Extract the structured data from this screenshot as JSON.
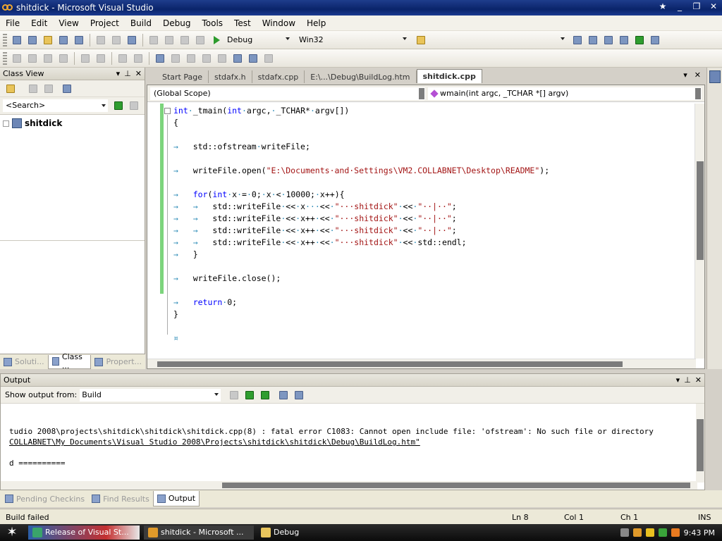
{
  "window": {
    "title": "shitdick - Microsoft Visual Studio"
  },
  "menu": [
    "File",
    "Edit",
    "View",
    "Project",
    "Build",
    "Debug",
    "Tools",
    "Test",
    "Window",
    "Help"
  ],
  "toolbar": {
    "config": "Debug",
    "platform": "Win32"
  },
  "class_view": {
    "title": "Class View",
    "search_placeholder": "<Search>",
    "tree_root": "shitdick",
    "tabs": [
      "Soluti...",
      "Class ...",
      "Propert..."
    ]
  },
  "editor": {
    "tabs": [
      "Start Page",
      "stdafx.h",
      "stdafx.cpp",
      "E:\\...\\Debug\\BuildLog.htm",
      "shitdick.cpp"
    ],
    "active_tab": "shitdick.cpp",
    "scope": "(Global Scope)",
    "member": "wmain(int argc, _TCHAR *[] argv)",
    "lines": [
      [
        [
          "kw",
          "int"
        ],
        [
          "ws",
          "·"
        ],
        [
          "plain",
          "_tmain("
        ],
        [
          "kw",
          "int"
        ],
        [
          "ws",
          "·"
        ],
        [
          "plain",
          "argc,"
        ],
        [
          "ws",
          "·"
        ],
        [
          "plain",
          "_TCHAR*"
        ],
        [
          "ws",
          "·"
        ],
        [
          "plain",
          "argv[])"
        ]
      ],
      [
        [
          "plain",
          "{"
        ]
      ],
      [],
      [
        [
          "ws",
          "→   "
        ],
        [
          "plain",
          "std::ofstream"
        ],
        [
          "ws",
          "·"
        ],
        [
          "plain",
          "writeFile;"
        ]
      ],
      [],
      [
        [
          "ws",
          "→   "
        ],
        [
          "plain",
          "writeFile.open("
        ],
        [
          "str",
          "\"E:\\Documents·and·Settings\\VM2.COLLABNET\\Desktop\\README\""
        ],
        [
          "plain",
          ");"
        ]
      ],
      [],
      [
        [
          "ws",
          "→   "
        ],
        [
          "kw",
          "for"
        ],
        [
          "plain",
          "("
        ],
        [
          "kw",
          "int"
        ],
        [
          "ws",
          "·"
        ],
        [
          "plain",
          "x"
        ],
        [
          "ws",
          "·"
        ],
        [
          "plain",
          "="
        ],
        [
          "ws",
          "·"
        ],
        [
          "plain",
          "0;"
        ],
        [
          "ws",
          "·"
        ],
        [
          "plain",
          "x"
        ],
        [
          "ws",
          "·"
        ],
        [
          "plain",
          "<"
        ],
        [
          "ws",
          "·"
        ],
        [
          "plain",
          "10000;"
        ],
        [
          "ws",
          "·"
        ],
        [
          "plain",
          "x++){"
        ]
      ],
      [
        [
          "ws",
          "→   →   "
        ],
        [
          "plain",
          "std::writeFile"
        ],
        [
          "ws",
          "·"
        ],
        [
          "plain",
          "<<"
        ],
        [
          "ws",
          "·"
        ],
        [
          "plain",
          "x"
        ],
        [
          "ws",
          "···"
        ],
        [
          "plain",
          "<<"
        ],
        [
          "ws",
          "·"
        ],
        [
          "str",
          "\"···shitdick\""
        ],
        [
          "ws",
          "·"
        ],
        [
          "plain",
          "<<"
        ],
        [
          "ws",
          "·"
        ],
        [
          "str",
          "\"··|··\""
        ],
        [
          "plain",
          ";"
        ]
      ],
      [
        [
          "ws",
          "→   →   "
        ],
        [
          "plain",
          "std::writeFile"
        ],
        [
          "ws",
          "·"
        ],
        [
          "plain",
          "<<"
        ],
        [
          "ws",
          "·"
        ],
        [
          "plain",
          "x++"
        ],
        [
          "ws",
          "·"
        ],
        [
          "plain",
          "<<"
        ],
        [
          "ws",
          "·"
        ],
        [
          "str",
          "\"···shitdick\""
        ],
        [
          "ws",
          "·"
        ],
        [
          "plain",
          "<<"
        ],
        [
          "ws",
          "·"
        ],
        [
          "str",
          "\"··|··\""
        ],
        [
          "plain",
          ";"
        ]
      ],
      [
        [
          "ws",
          "→   →   "
        ],
        [
          "plain",
          "std::writeFile"
        ],
        [
          "ws",
          "·"
        ],
        [
          "plain",
          "<<"
        ],
        [
          "ws",
          "·"
        ],
        [
          "plain",
          "x++"
        ],
        [
          "ws",
          "·"
        ],
        [
          "plain",
          "<<"
        ],
        [
          "ws",
          "·"
        ],
        [
          "str",
          "\"···shitdick\""
        ],
        [
          "ws",
          "·"
        ],
        [
          "plain",
          "<<"
        ],
        [
          "ws",
          "·"
        ],
        [
          "str",
          "\"··|··\""
        ],
        [
          "plain",
          ";"
        ]
      ],
      [
        [
          "ws",
          "→   →   "
        ],
        [
          "plain",
          "std::writeFile"
        ],
        [
          "ws",
          "·"
        ],
        [
          "plain",
          "<<"
        ],
        [
          "ws",
          "·"
        ],
        [
          "plain",
          "x++"
        ],
        [
          "ws",
          "·"
        ],
        [
          "plain",
          "<<"
        ],
        [
          "ws",
          "·"
        ],
        [
          "str",
          "\"···shitdick\""
        ],
        [
          "ws",
          "·"
        ],
        [
          "plain",
          "<<"
        ],
        [
          "ws",
          "·"
        ],
        [
          "plain",
          "std::endl;"
        ]
      ],
      [
        [
          "ws",
          "→   "
        ],
        [
          "plain",
          "}"
        ]
      ],
      [],
      [
        [
          "ws",
          "→   "
        ],
        [
          "plain",
          "writeFile.close();"
        ]
      ],
      [],
      [
        [
          "ws",
          "→   "
        ],
        [
          "kw",
          "return"
        ],
        [
          "ws",
          "·"
        ],
        [
          "plain",
          "0;"
        ]
      ],
      [
        [
          "plain",
          "}"
        ]
      ],
      [],
      [
        [
          "ws",
          "¤"
        ]
      ]
    ]
  },
  "output": {
    "title": "Output",
    "show_from_label": "Show output from:",
    "show_from_value": "Build",
    "lines": [
      "tudio 2008\\projects\\shitdick\\shitdick\\shitdick.cpp(8) : fatal error C1083: Cannot open include file: 'ofstream': No such file or directory",
      "COLLABNET\\My Documents\\Visual Studio 2008\\Projects\\shitdick\\shitdick\\Debug\\BuildLog.htm\"",
      "",
      "d =========="
    ],
    "tabs": [
      "Pending Checkins",
      "Find Results",
      "Output"
    ]
  },
  "status": {
    "message": "Build failed",
    "ln": "Ln 8",
    "col": "Col 1",
    "ch": "Ch 1",
    "mode": "INS"
  },
  "taskbar": {
    "buttons": [
      "Release of Visual St...",
      "shitdick - Microsoft ...",
      "Debug"
    ],
    "clock": "9:43 PM"
  }
}
